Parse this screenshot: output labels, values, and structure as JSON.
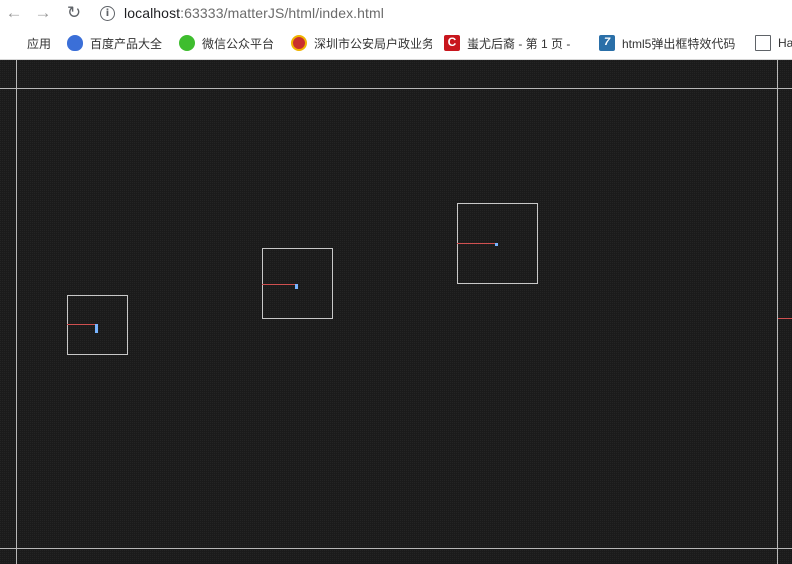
{
  "browser": {
    "back_icon": "arrow-left-icon",
    "forward_icon": "arrow-right-icon",
    "reload_icon": "reload-icon",
    "info_icon": "info-icon",
    "url_host": "localhost",
    "url_rest": ":63333/matterJS/html/index.html"
  },
  "bookmarks": [
    {
      "label": "应用",
      "icon": "apps-grid-icon"
    },
    {
      "label": "百度产品大全",
      "icon": "baidu-paw-icon"
    },
    {
      "label": "微信公众平台",
      "icon": "wechat-icon"
    },
    {
      "label": "深圳市公安局户政业务",
      "icon": "police-badge-icon"
    },
    {
      "label": "蚩尤后裔 - 第 1 页 -",
      "icon": "c-logo-icon"
    },
    {
      "label": "html5弹出框特效代码",
      "icon": "h5-logo-icon"
    },
    {
      "label": "Ha",
      "icon": "document-icon"
    }
  ],
  "colors": {
    "canvas_background": "#1b1b1b",
    "wall_stroke": "#b8b8b8",
    "box_stroke": "#c8c8c8",
    "angle_line": "#d05050",
    "body_marker": "#78b4ff"
  }
}
